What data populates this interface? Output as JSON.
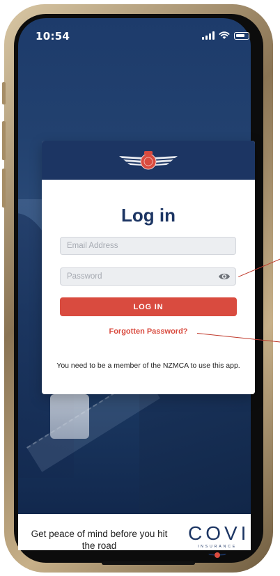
{
  "status_bar": {
    "time": "10:54"
  },
  "card": {
    "title": "Log in",
    "email": {
      "placeholder": "Email Address",
      "value": ""
    },
    "password": {
      "placeholder": "Password",
      "value": ""
    },
    "login_label": "LOG IN",
    "forgot_label": "Forgotten Password?",
    "note": "You need to be a member of the NZMCA to use this app."
  },
  "footer": {
    "promo": "Get peace of mind before you hit the road",
    "brand_name": "COVI",
    "brand_sub": "INSURANCE"
  },
  "icons": {
    "logo": "nzmca-winged-emblem-icon",
    "password_toggle": "eye-icon",
    "signal": "cellular-signal-icon",
    "wifi": "wifi-icon",
    "battery": "battery-icon"
  },
  "colors": {
    "primary_navy": "#1c3563",
    "accent_red": "#d94b3f",
    "field_bg": "#eceef1"
  }
}
